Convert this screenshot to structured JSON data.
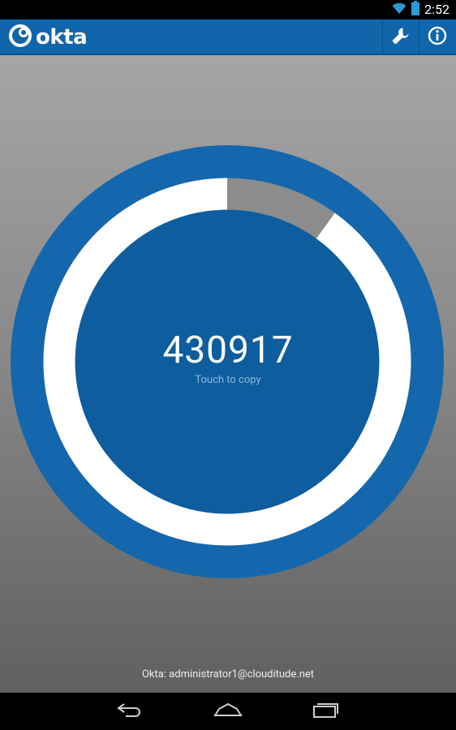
{
  "status_bar": {
    "time": "2:52",
    "icons": [
      "wifi-icon",
      "battery-icon"
    ]
  },
  "action_bar": {
    "app_name": "okta",
    "logo_icon": "okta-logo-icon",
    "actions": [
      {
        "name": "settings",
        "icon": "wrench-icon"
      },
      {
        "name": "about",
        "icon": "info-icon"
      }
    ],
    "color": "#1065ab"
  },
  "token": {
    "code": "430917",
    "hint": "Touch to copy",
    "time_remaining_fraction": 0.9
  },
  "account": {
    "label": "Okta: administrator1@clouditude.net"
  },
  "nav_bar": {
    "buttons": [
      "back-icon",
      "home-icon",
      "recent-apps-icon"
    ]
  },
  "colors": {
    "accent": "#1065ab",
    "dial_ring": "#1467ac",
    "dial_center": "#0e5d9e",
    "progress_fill": "#ffffff",
    "progress_track": "#8c8c8c"
  }
}
